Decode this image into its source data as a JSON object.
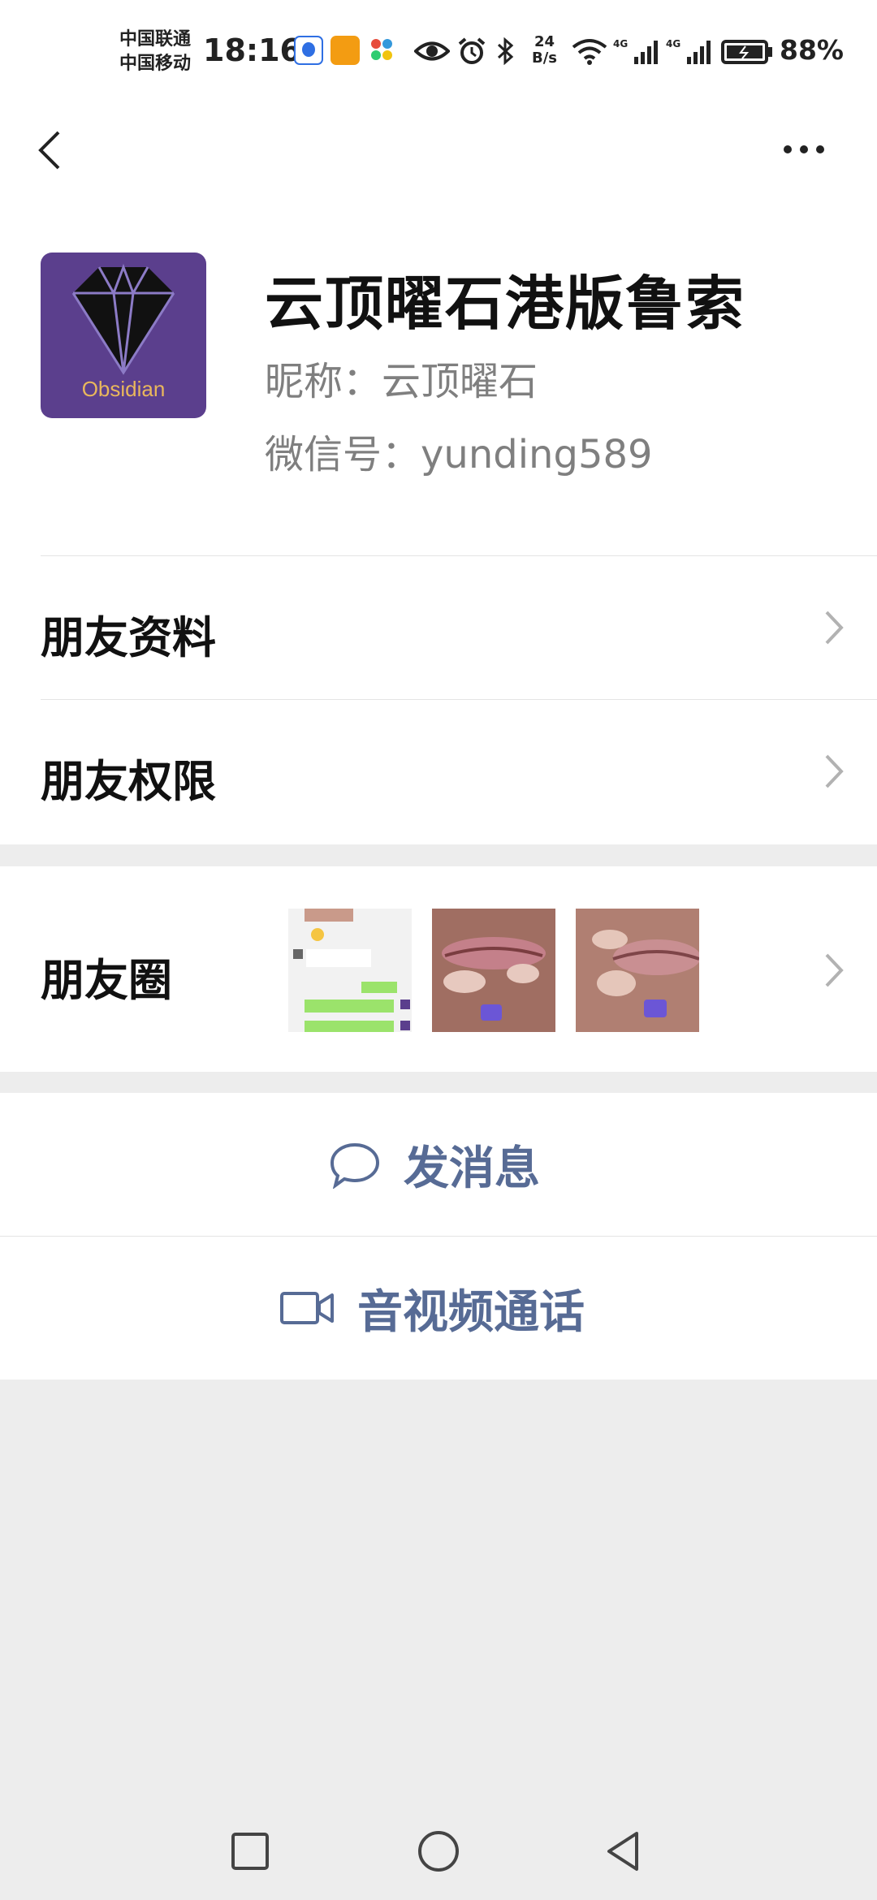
{
  "status_bar": {
    "carrier_1": "中国联通",
    "carrier_2": "中国移动",
    "time": "18:16",
    "speed_value": "24",
    "speed_unit": "B/s",
    "net_1": "4G",
    "net_2": "4G",
    "battery": "88%",
    "icons": [
      "baidu-app-icon",
      "imou-app-icon",
      "pinwheel-app-icon",
      "eye-icon",
      "alarm-icon",
      "bluetooth-icon",
      "wifi-icon",
      "signal-icon",
      "signal-icon",
      "battery-icon"
    ]
  },
  "nav": {
    "back_icon": "back-chevron-icon",
    "more_icon": "more-dots-icon"
  },
  "profile": {
    "avatar_text": "Obsidian",
    "display_name": "云顶曜石港版鲁索",
    "nickname": "昵称：云顶曜石",
    "wechat_id": "微信号：yunding589"
  },
  "rows": {
    "friend_info": "朋友资料",
    "friend_permissions": "朋友权限",
    "moments": "朋友圈"
  },
  "actions": {
    "send_message": "发消息",
    "video_call": "音视频通话"
  },
  "colors": {
    "link_blue": "#576b95",
    "page_bg": "#ededed",
    "avatar_bg": "#5b3f8d"
  }
}
